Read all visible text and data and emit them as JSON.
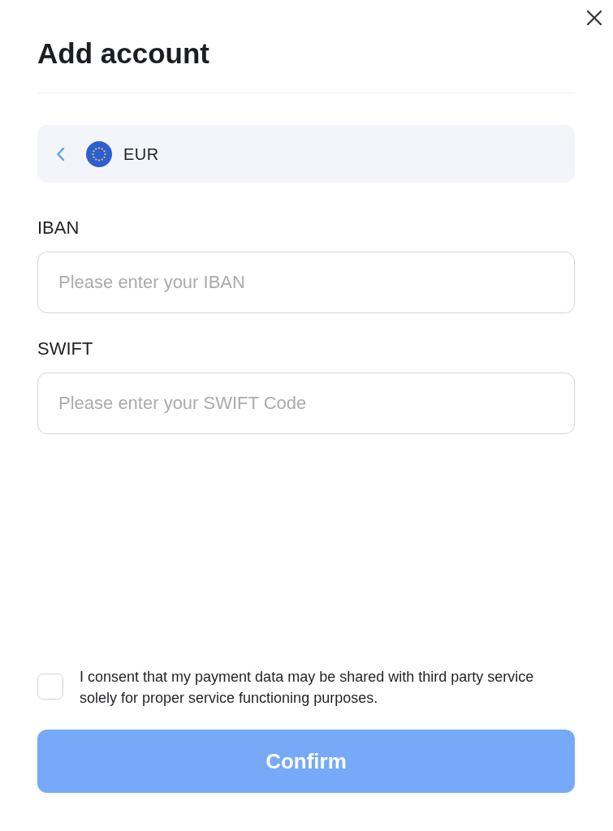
{
  "header": {
    "title": "Add account"
  },
  "currency": {
    "code": "EUR"
  },
  "fields": [
    {
      "label": "IBAN",
      "placeholder": "Please enter your IBAN"
    },
    {
      "label": "SWIFT",
      "placeholder": "Please enter your SWIFT Code"
    }
  ],
  "consent": {
    "checked": false,
    "text": "I consent that my payment data may be shared with third party service solely for proper service functioning purposes."
  },
  "confirm": {
    "label": "Confirm",
    "disabled": true
  }
}
